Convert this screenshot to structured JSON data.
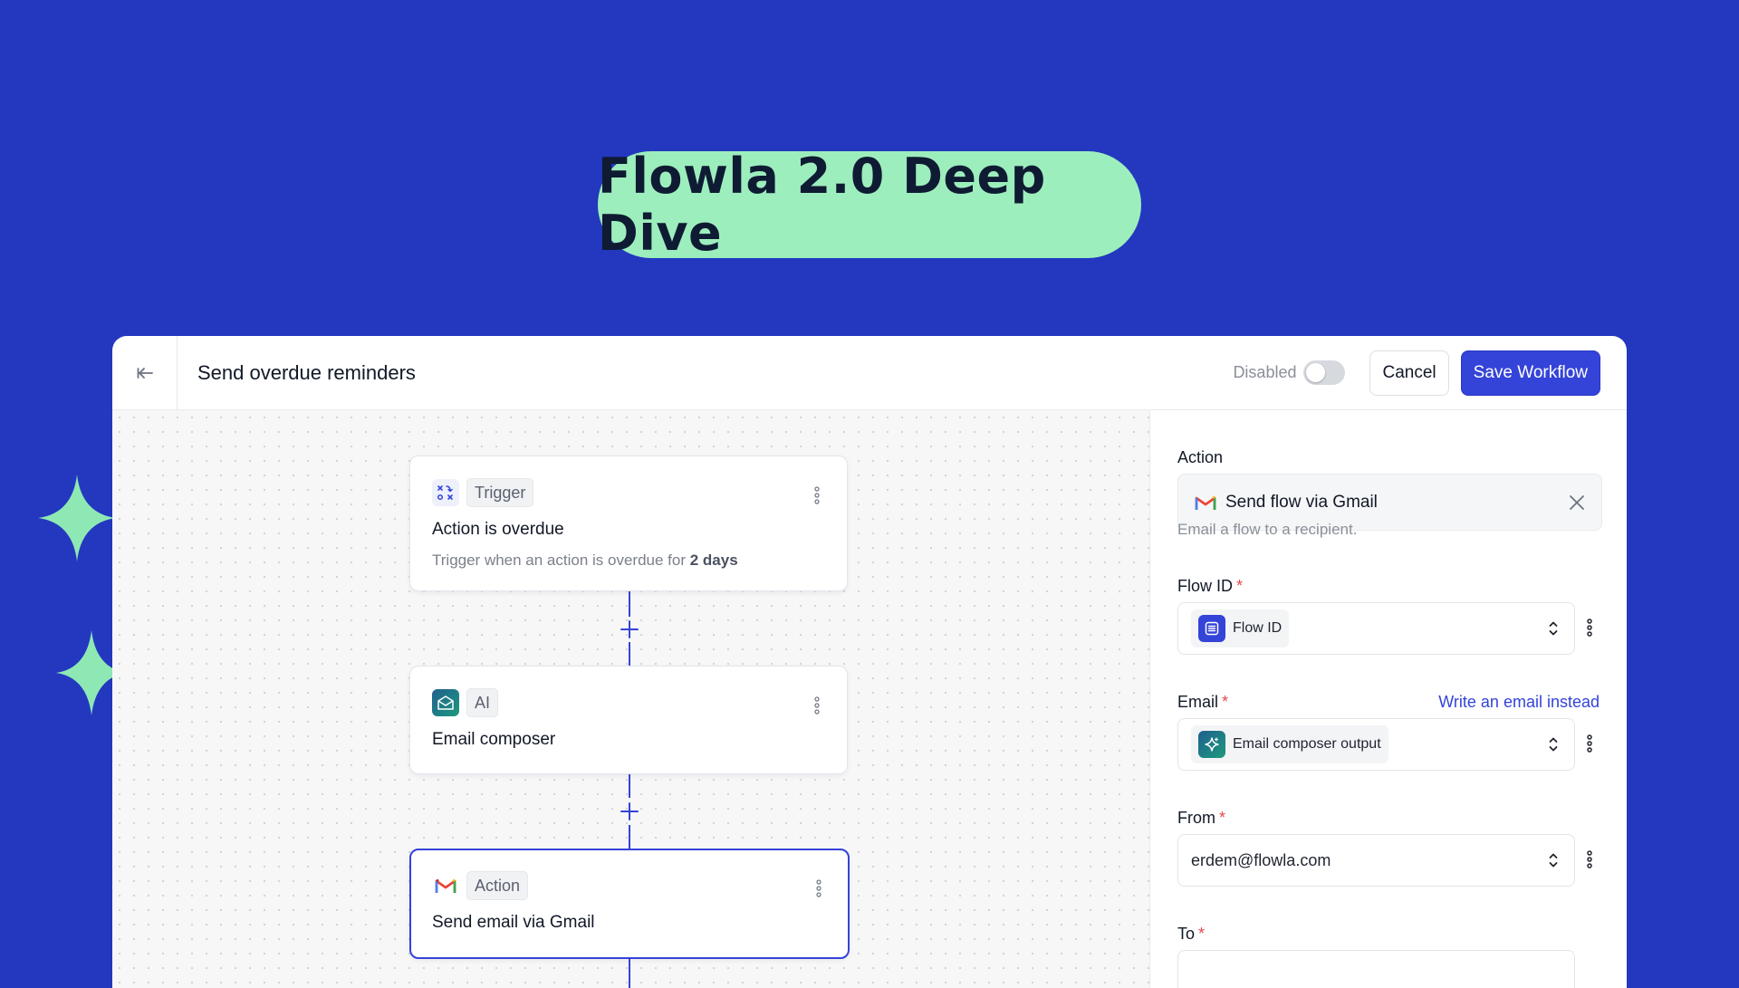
{
  "hero": {
    "title": "Flowla 2.0 Deep Dive"
  },
  "colors": {
    "background": "#2338bf",
    "pill": "#9deebd",
    "accent": "#3443d8",
    "sparkle": "#8ee8b4"
  },
  "header": {
    "back_icon": "arrow-left-icon",
    "title": "Send overdue reminders",
    "toggle_label": "Disabled",
    "toggle_on": false,
    "cancel_label": "Cancel",
    "save_label": "Save Workflow"
  },
  "nodes": [
    {
      "tag": "Trigger",
      "icon": "trigger-icon",
      "title": "Action is overdue",
      "desc_prefix": "Trigger when an action is overdue for ",
      "desc_bold": "2 days"
    },
    {
      "tag": "AI",
      "icon": "ai-email-icon",
      "title": "Email composer"
    },
    {
      "tag": "Action",
      "icon": "gmail-icon",
      "title": "Send email via Gmail",
      "selected": true
    }
  ],
  "panel": {
    "action_label": "Action",
    "action_value": "Send flow via Gmail",
    "action_help": "Email a flow to a recipient.",
    "flow_id_label": "Flow ID",
    "flow_id_value": "Flow ID",
    "email_label": "Email",
    "email_link": "Write an email instead",
    "email_value": "Email composer output",
    "from_label": "From",
    "from_value": "erdem@flowla.com",
    "to_label": "To",
    "required_mark": "*"
  }
}
